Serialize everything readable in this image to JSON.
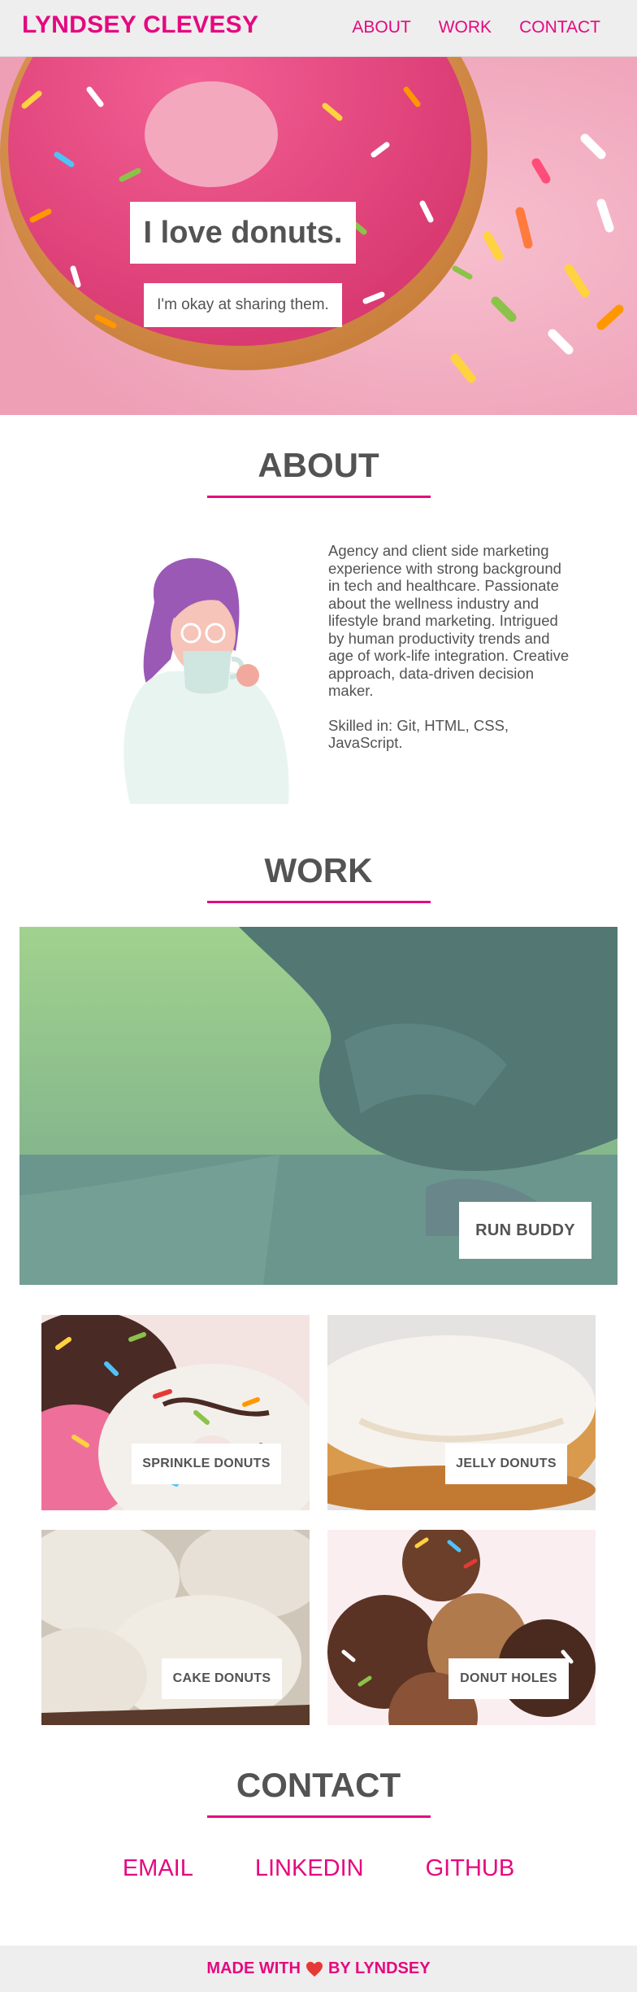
{
  "header": {
    "brand": "LYNDSEY CLEVESY",
    "nav": [
      {
        "label": "ABOUT"
      },
      {
        "label": "WORK"
      },
      {
        "label": "CONTACT"
      }
    ]
  },
  "hero": {
    "title": "I love donuts.",
    "subtitle": "I'm okay at sharing them."
  },
  "about": {
    "heading": "ABOUT",
    "bio": "Agency and client side marketing experience with strong background in tech and healthcare. Passionate about the wellness industry and lifestyle brand marketing. Intrigued by human productivity trends and age of work-life integration. Creative approach, data-driven decision maker.",
    "skills": "Skilled in: Git, HTML, CSS, JavaScript."
  },
  "work": {
    "heading": "WORK",
    "featured": {
      "label": "RUN BUDDY"
    },
    "projects": [
      {
        "label": "SPRINKLE DONUTS"
      },
      {
        "label": "JELLY DONUTS"
      },
      {
        "label": "CAKE DONUTS"
      },
      {
        "label": "DONUT HOLES"
      }
    ]
  },
  "contact": {
    "heading": "CONTACT",
    "links": [
      {
        "label": "EMAIL"
      },
      {
        "label": "LINKEDIN"
      },
      {
        "label": "GITHUB"
      }
    ]
  },
  "footer": {
    "prefix": "MADE WITH",
    "suffix": "BY LYNDSEY",
    "icon": "heart-icon"
  },
  "colors": {
    "accent": "#e5087f",
    "text": "#535353",
    "nav_bg": "#eeeeee"
  }
}
